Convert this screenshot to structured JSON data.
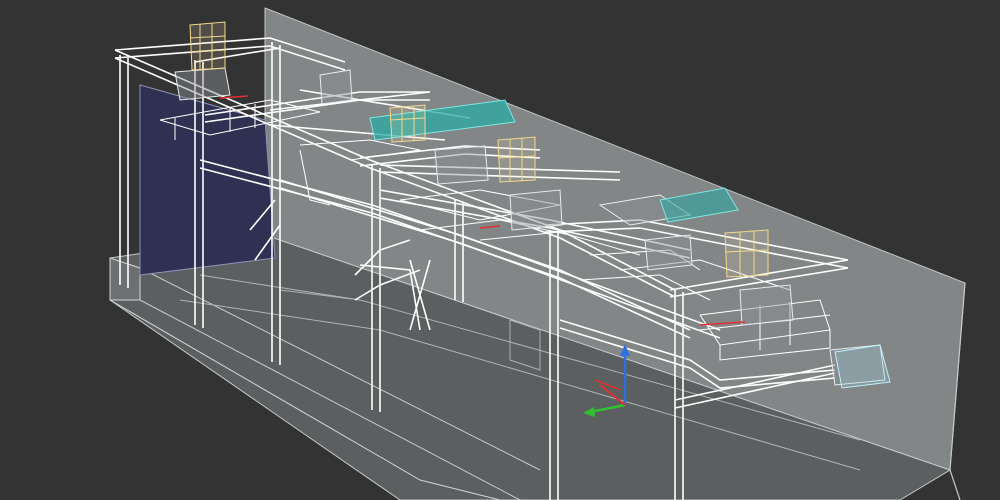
{
  "viewport": {
    "background_color": "#333333",
    "render_mode": "wireframe-over-shaded",
    "axis_gizmo": {
      "x_color": "#e03030",
      "y_color": "#30c030",
      "z_color": "#2f6fe0"
    }
  },
  "model": {
    "hall_wall_color": "#7f8384",
    "floor_color": "#585b5c",
    "frame_color": "#ffffff",
    "duct_color": "#2aa9a4",
    "fan_box_color": "#e8cf8a",
    "panel_color": "#2f3152",
    "accent_color": "#e03030"
  }
}
